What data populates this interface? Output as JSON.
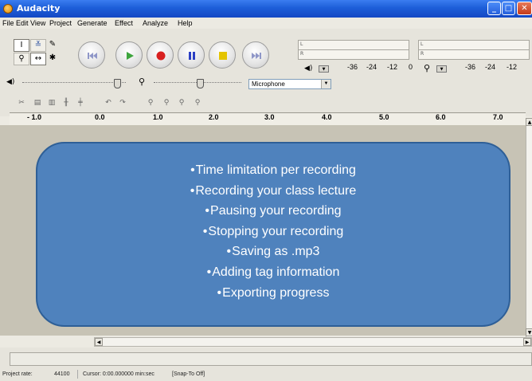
{
  "window": {
    "title": "Audacity"
  },
  "menu": [
    "File",
    "Edit",
    "View",
    "Project",
    "Generate",
    "Effect",
    "Analyze",
    "Help"
  ],
  "meters": {
    "left_label": "L",
    "right_label": "R",
    "output_scale": [
      "-36",
      "-24",
      "-12",
      "0"
    ],
    "input_scale": [
      "-36",
      "-24",
      "-12"
    ]
  },
  "input_source": {
    "selected": "Microphone"
  },
  "ruler": [
    "- 1.0",
    "0.0",
    "1.0",
    "2.0",
    "3.0",
    "4.0",
    "5.0",
    "6.0",
    "7.0"
  ],
  "overlay": {
    "bullet": "•",
    "items": [
      "Time limitation per recording",
      "Recording your class lecture",
      "Pausing your recording",
      "Stopping your recording",
      "Saving as .mp3",
      "Adding tag information",
      "Exporting progress"
    ]
  },
  "status": {
    "project_rate_label": "Project rate:",
    "project_rate_value": "44100",
    "cursor_text": "Cursor: 0:00.000000 min:sec",
    "snap_text": "[Snap-To Off]"
  },
  "icons": [
    "app-icon",
    "minimize-icon",
    "maximize-icon",
    "close-icon",
    "selection-tool-icon",
    "envelope-tool-icon",
    "draw-tool-icon",
    "zoom-tool-icon",
    "timeshift-tool-icon",
    "multi-tool-icon",
    "skip-start-icon",
    "play-icon",
    "record-icon",
    "pause-icon",
    "stop-icon",
    "skip-end-icon",
    "speaker-icon",
    "microphone-icon",
    "cut-icon",
    "copy-icon",
    "paste-icon",
    "trim-icon",
    "silence-icon",
    "undo-icon",
    "redo-icon",
    "zoom-in-icon",
    "zoom-out-icon",
    "fit-selection-icon",
    "fit-project-icon"
  ]
}
